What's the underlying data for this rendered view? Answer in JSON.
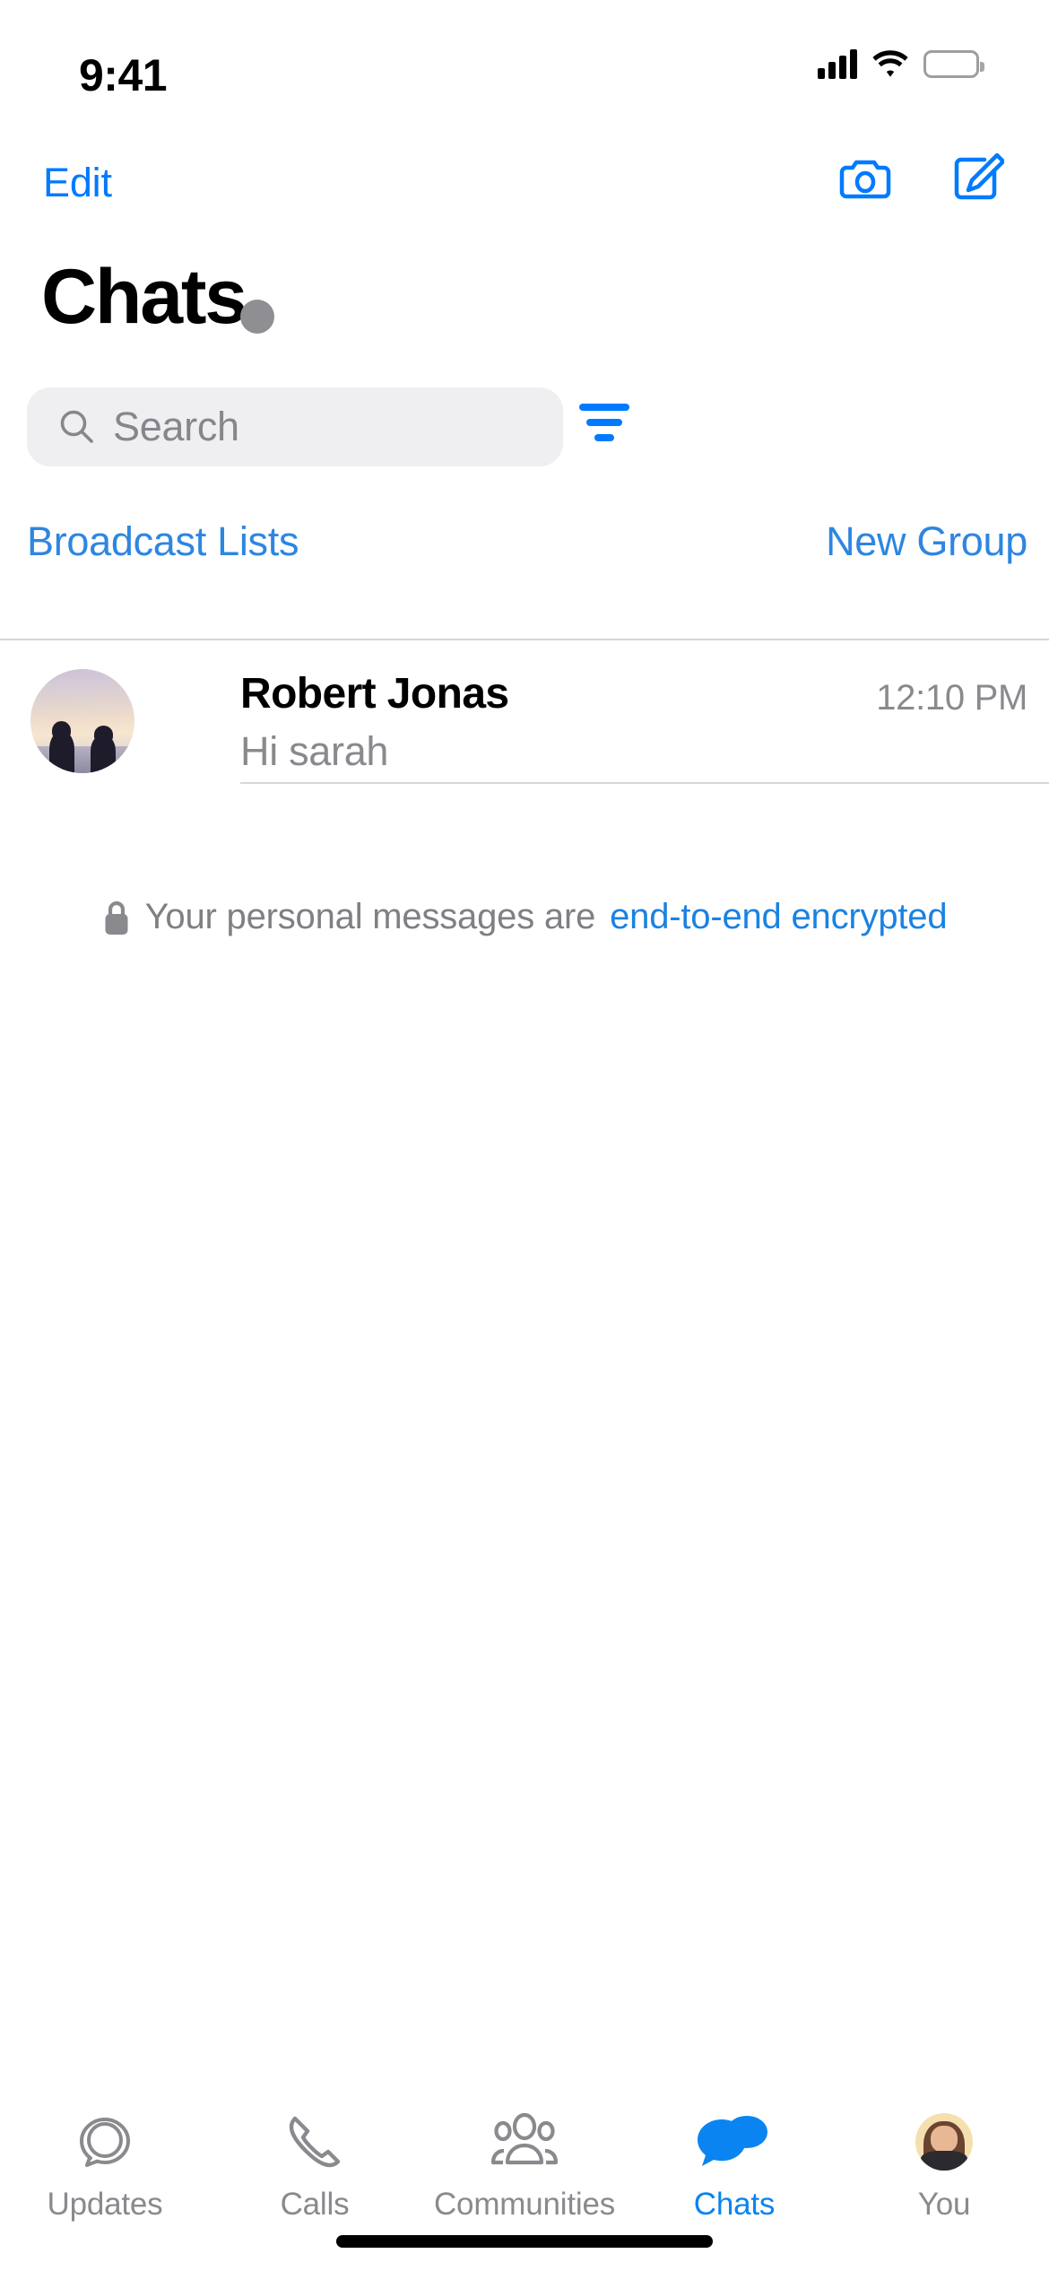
{
  "status_bar": {
    "time": "9:41",
    "signal_icon": "cellular-signal-icon",
    "wifi_icon": "wifi-icon",
    "battery_icon": "battery-icon"
  },
  "nav_bar": {
    "edit_label": "Edit",
    "camera_icon": "camera-icon",
    "compose_icon": "compose-icon"
  },
  "header": {
    "title": "Chats"
  },
  "search": {
    "placeholder": "Search",
    "value": "",
    "search_icon": "search-icon",
    "filter_icon": "filter-icon"
  },
  "quick_links": {
    "broadcast_label": "Broadcast Lists",
    "new_group_label": "New Group"
  },
  "chats": [
    {
      "name": "Robert Jonas",
      "preview": "Hi sarah",
      "time": "12:10 PM",
      "avatar": "sunset-couple-photo-avatar"
    }
  ],
  "encryption_notice": {
    "lock_icon": "lock-icon",
    "text": "Your personal messages are",
    "link_text": "end-to-end encrypted"
  },
  "tab_bar": {
    "items": [
      {
        "label": "Updates",
        "icon": "status-updates-icon",
        "active": false
      },
      {
        "label": "Calls",
        "icon": "phone-icon",
        "active": false
      },
      {
        "label": "Communities",
        "icon": "communities-icon",
        "active": false
      },
      {
        "label": "Chats",
        "icon": "chat-bubbles-icon",
        "active": true
      },
      {
        "label": "You",
        "icon": "profile-avatar-icon",
        "active": false
      }
    ]
  },
  "colors": {
    "accent_blue": "#007AFF",
    "link_blue": "#2E86E0",
    "tab_active_blue": "#0A84F0",
    "secondary_text": "#8A898E",
    "search_background": "#EFEEF1",
    "separator": "#D6D6DA"
  }
}
